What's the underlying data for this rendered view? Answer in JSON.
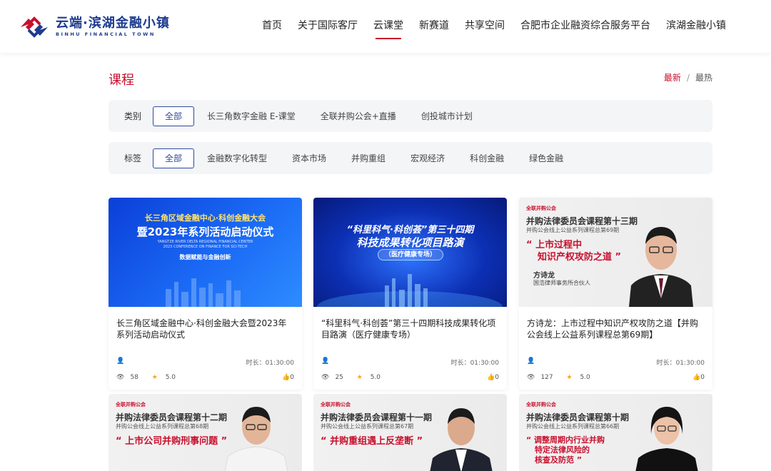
{
  "header": {
    "logo_cn": "云端·滨湖金融小镇",
    "logo_en": "BINHU FINANCIAL TOWN",
    "nav": [
      {
        "label": "首页",
        "active": false
      },
      {
        "label": "关于国际客厅",
        "active": false
      },
      {
        "label": "云课堂",
        "active": true
      },
      {
        "label": "新赛道",
        "active": false
      },
      {
        "label": "共享空间",
        "active": false
      },
      {
        "label": "合肥市企业融资综合服务平台",
        "active": false
      },
      {
        "label": "滨湖金融小镇",
        "active": false
      }
    ]
  },
  "page": {
    "title": "课程",
    "sort_latest": "最新",
    "sort_sep": "/",
    "sort_hot": "最热"
  },
  "filters": {
    "category": {
      "label": "类别",
      "options": [
        "全部",
        "长三角数字金融 E-课堂",
        "全联并购公会+直播",
        "创投城市计划"
      ]
    },
    "tag": {
      "label": "标签",
      "options": [
        "全部",
        "金融数字化转型",
        "资本市场",
        "并购重组",
        "宏观经济",
        "科创金融",
        "绿色金融"
      ]
    }
  },
  "cards": [
    {
      "title": "长三角区域金融中心·科创金融大会暨2023年系列活动启动仪式",
      "duration": "时长：01:30:00",
      "views": "58",
      "rating": "5.0",
      "likes": "0",
      "thumb": {
        "line1": "长三角区域金融中心·科创金融大会",
        "line2": "暨2023年系列活动启动仪式",
        "en1": "YANGTZE RIVER DELTA REGIONAL FINANCIAL CENTER",
        "en2": "2023 CONFERENCE ON FINANCE FOR SCI-TECH",
        "tagline": "数据赋能与金融创新"
      }
    },
    {
      "title": "“科里科气·科创荟”第三十四期科技成果转化项目路演（医疗健康专场）",
      "duration": "时长：01:30:00",
      "views": "25",
      "rating": "5.0",
      "likes": "0",
      "thumb": {
        "line1": "“科里科气·科创荟”第三十四期",
        "line2": "科技成果转化项目路演",
        "tagline": "（医疗健康专场）"
      }
    },
    {
      "title": "方诗龙：上市过程中知识产权攻防之道【并购公会线上公益系列课程总第69期】",
      "duration": "时长：01:30:00",
      "views": "127",
      "rating": "5.0",
      "likes": "0",
      "thumb": {
        "org": "全联并购公会",
        "title": "并购法律委员会课程第十三期",
        "sub": "并购公会线上公益系列课程总第69期",
        "quote1": "上市过程中",
        "quote2": "知识产权攻防之道",
        "name": "方诗龙",
        "role": "国浩律师事务所合伙人"
      }
    },
    {
      "thumb": {
        "org": "全联并购公会",
        "title": "并购法律委员会课程第十二期",
        "sub": "并购公会线上公益系列课程总第68期",
        "quote1": "上市公司并购刑事问题",
        "quote2": ""
      }
    },
    {
      "thumb": {
        "org": "全联并购公会",
        "title": "并购法律委员会课程第十一期",
        "sub": "并购公会线上公益系列课程总第67期",
        "quote1": "并购重组遇上反垄断",
        "quote2": ""
      }
    },
    {
      "thumb": {
        "org": "全联并购公会",
        "title": "并购法律委员会课程第十期",
        "sub": "并购公会线上公益系列课程总第66期",
        "quote1": "调整周期内行业并购",
        "quote2": "特定法律风险的",
        "quote3": "核查及防范"
      }
    }
  ]
}
